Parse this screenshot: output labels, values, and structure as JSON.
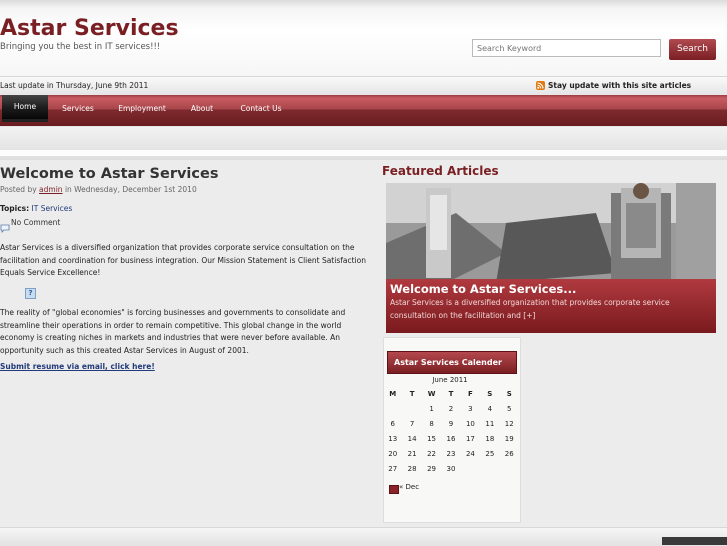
{
  "header": {
    "site_title": "Astar Services",
    "tagline": "Bringing you the best in IT services!!!",
    "search_placeholder": "Search Keyword",
    "search_button": "Search"
  },
  "update_bar": {
    "last_update": "Last update in Thursday, June 9th 2011",
    "rss_text": "Stay update with this site articles"
  },
  "nav": {
    "items": [
      {
        "label": "Home"
      },
      {
        "label": "Services"
      },
      {
        "label": "Employment"
      },
      {
        "label": "About"
      },
      {
        "label": "Contact Us"
      }
    ]
  },
  "post": {
    "title": "Welcome to Astar Services",
    "meta_prefix": "Posted by",
    "author": "admin",
    "meta_suffix": "in Wednesday, December 1st 2010",
    "topics_label": "Topics:",
    "topic": "IT Services",
    "comments": "No Comment",
    "paragraph_1": "Astar Services is a diversified organization that provides corporate service consultation on the facilitation and coordination for business integration. Our Mission Statement is Client Satisfaction Equals Service Excellence!",
    "broken_image_glyph": "?",
    "paragraph_2": "The reality of \"global economies\" is forcing businesses and governments to consolidate and streamline their operations in order to remain competitive. This global change in the world economy is creating niches in markets and industries that were never before available. An opportunity such as this created Astar Services in August of 2001.",
    "resume_link": "Submit resume via email, click here!"
  },
  "featured": {
    "heading": "Featured Articles",
    "title": "Welcome to Astar Services...",
    "excerpt": "Astar Services is a diversified organization that provides corporate service consultation on the facilitation and [+]"
  },
  "calendar": {
    "title": "Astar Services Calender",
    "caption": "June 2011",
    "weekdays": [
      "M",
      "T",
      "W",
      "T",
      "F",
      "S",
      "S"
    ],
    "weeks": [
      [
        "",
        "",
        "1",
        "2",
        "3",
        "4",
        "5"
      ],
      [
        "6",
        "7",
        "8",
        "9",
        "10",
        "11",
        "12"
      ],
      [
        "13",
        "14",
        "15",
        "16",
        "17",
        "18",
        "19"
      ],
      [
        "20",
        "21",
        "22",
        "23",
        "24",
        "25",
        "26"
      ],
      [
        "27",
        "28",
        "29",
        "30",
        "",
        "",
        ""
      ]
    ],
    "prev_link": "« Dec"
  },
  "colors": {
    "brand": "#7a1f23",
    "nav_active": "#000000",
    "rss": "#e07b14"
  }
}
